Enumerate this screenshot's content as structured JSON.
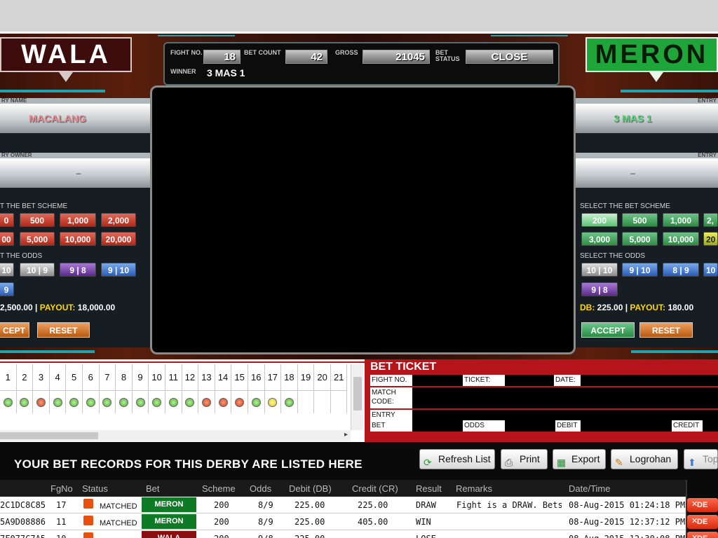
{
  "wala": {
    "label": "WALA",
    "entry_name_label": "RY NAME",
    "entry_name": "MACALANG",
    "entry_owner_label": "RY OWNER",
    "entry_owner": "–",
    "scheme_label": "T THE BET SCHEME",
    "schemes": [
      "0",
      "500",
      "1,000",
      "2,000",
      "00",
      "5,000",
      "10,000",
      "20,000"
    ],
    "odds_label": "T THE ODDS",
    "odds": [
      "10",
      "10 | 9",
      "9 | 8",
      "9 | 10",
      "9"
    ],
    "db_text": "2,500.00",
    "payout_label": "PAYOUT:",
    "payout": "18,000.00",
    "accept": "CEPT",
    "reset": "RESET"
  },
  "meron": {
    "label": "MERON",
    "entry_name_label": "ENTRY",
    "entry_name": "3 MAS 1",
    "entry_owner_label": "ENTRY",
    "entry_owner": "–",
    "scheme_label": "SELECT THE BET SCHEME",
    "schemes": [
      "200",
      "500",
      "1,000",
      "2,",
      "3,000",
      "5,000",
      "10,000",
      "20"
    ],
    "odds_label": "SELECT THE ODDS",
    "odds": [
      "10 | 10",
      "9 | 10",
      "8 | 9",
      "10",
      "9 | 8"
    ],
    "db_label": "DB:",
    "db_text": "225.00",
    "payout_label": "PAYOUT:",
    "payout": "180.00",
    "accept": "ACCEPT",
    "reset": "RESET"
  },
  "fight": {
    "fight_no_label": "FIGHT NO.",
    "fight_no": "18",
    "bet_count_label": "BET COUNT",
    "bet_count": "42",
    "gross_label": "GROSS",
    "gross": "21045",
    "bet_status_label_1": "BET",
    "bet_status_label_2": "STATUS",
    "bet_status": "CLOSE",
    "winner_label": "WINNER",
    "winner": "3 MAS 1"
  },
  "results_grid": {
    "numbers": [
      "1",
      "2",
      "3",
      "4",
      "5",
      "6",
      "7",
      "8",
      "9",
      "10",
      "11",
      "12",
      "13",
      "14",
      "15",
      "16",
      "17",
      "18",
      "19",
      "20",
      "21"
    ],
    "results": [
      "green",
      "green",
      "red",
      "green",
      "green",
      "green",
      "green",
      "green",
      "green",
      "green",
      "green",
      "green",
      "red",
      "red",
      "red",
      "green",
      "yellow",
      "green",
      "none",
      "none",
      "none"
    ]
  },
  "ticket": {
    "title": "BET TICKET",
    "fight_no_label": "FIGHT NO.",
    "ticket_label": "TICKET:",
    "date_label": "DATE:",
    "match_code_label": "MATCH CODE:",
    "entry_label": "ENTRY",
    "bet_label": "BET",
    "odds_label": "ODDS",
    "debit_label": "DEBIT",
    "credit_label": "CREDIT"
  },
  "records": {
    "title": "YOUR BET RECORDS FOR THIS DERBY ARE LISTED HERE",
    "buttons": [
      "Refresh List",
      "Print",
      "Export",
      "Logrohan",
      "Top"
    ],
    "columns": [
      "FgNo",
      "Status",
      "Bet",
      "Scheme",
      "Odds",
      "Debit (DB)",
      "Credit (CR)",
      "Result",
      "Remarks",
      "Date/Time"
    ],
    "rows": [
      {
        "id": "2C1DC8C85",
        "fg": "17",
        "status": "MATCHED",
        "bet": "MERON",
        "bet_color": "meron",
        "scheme": "200",
        "odds": "8/9",
        "debit": "225.00",
        "credit": "225.00",
        "result": "DRAW",
        "remarks": "Fight is a DRAW. Bets r",
        "datetime": "08-Aug-2015 01:24:18 PM",
        "action": "DE"
      },
      {
        "id": "5A9D08886",
        "fg": "11",
        "status": "MATCHED",
        "bet": "MERON",
        "bet_color": "meron",
        "scheme": "200",
        "odds": "8/9",
        "debit": "225.00",
        "credit": "405.00",
        "result": "WIN",
        "remarks": "",
        "datetime": "08-Aug-2015 12:37:12 PM",
        "action": "DE"
      },
      {
        "id": "7F077C7A5",
        "fg": "10",
        "status": "",
        "bet": "WALA",
        "bet_color": "wala",
        "scheme": "200",
        "odds": "9/8",
        "debit": "225.00",
        "credit": "",
        "result": "LOSE",
        "remarks": "",
        "datetime": "08-Aug-2015 12:30:08 PM",
        "action": "DE"
      }
    ]
  },
  "colors": {
    "wala": "#3d0d0d",
    "meron": "#1fa63a",
    "ticket_red": "#b5141b"
  }
}
